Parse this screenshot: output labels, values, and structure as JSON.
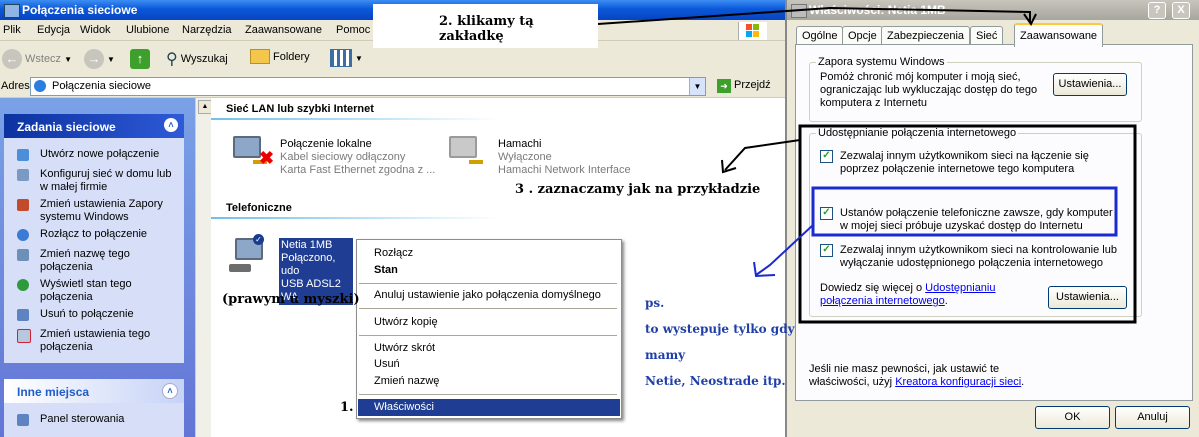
{
  "explorer": {
    "title": "Połączenia sieciowe",
    "menu": [
      "Plik",
      "Edycja",
      "Widok",
      "Ulubione",
      "Narzędzia",
      "Zaawansowane",
      "Pomoc"
    ],
    "toolbar": {
      "back": "Wstecz",
      "search": "Wyszukaj",
      "folders": "Foldery"
    },
    "address": {
      "label": "Adres",
      "value": "Połączenia sieciowe",
      "go": "Przejdź"
    },
    "tasks": {
      "header": "Zadania sieciowe",
      "items": [
        "Utwórz nowe połączenie",
        "Konfiguruj sieć w domu lub w małej firmie",
        "Zmień ustawienia Zapory systemu Windows",
        "Rozłącz to połączenie",
        "Zmień nazwę tego połączenia",
        "Wyświetl stan tego połączenia",
        "Usuń to połączenie",
        "Zmień ustawienia tego połączenia"
      ]
    },
    "places": {
      "header": "Inne miejsca",
      "items": [
        "Panel sterowania"
      ]
    },
    "groups": {
      "lan": "Sieć LAN lub szybki Internet",
      "phone": "Telefoniczne"
    },
    "connections": {
      "local": {
        "name": "Połączenie lokalne",
        "status": "Kabel sieciowy odłączony",
        "device": "Karta Fast Ethernet zgodna z ..."
      },
      "hamachi": {
        "name": "Hamachi",
        "status": "Wyłączone",
        "device": "Hamachi Network Interface"
      },
      "netia": {
        "name": "Netia 1MB",
        "status": "Połączono, udo",
        "device": "USB ADSL2 WA"
      }
    },
    "context_menu": {
      "items": [
        "Rozłącz",
        "Stan",
        "Anuluj ustawienie jako połączenia domyślnego",
        "Utwórz kopię",
        "Utwórz skrót",
        "Usuń",
        "Zmień nazwę",
        "Właściwości"
      ]
    }
  },
  "props": {
    "title": "Właściwości: Netia 1MB",
    "tabs": [
      "Ogólne",
      "Opcje",
      "Zabezpieczenia",
      "Sieć",
      "Zaawansowane"
    ],
    "firewall": {
      "legend": "Zapora systemu Windows",
      "text": [
        "Pomóż chronić mój komputer i moją sieć,",
        "ograniczając lub wykluczając dostęp do tego",
        "komputera z Internetu"
      ],
      "button": "Ustawienia..."
    },
    "ics": {
      "legend": "Udostępnianie połączenia internetowego",
      "cb1": [
        "Zezwalaj innym użytkownikom sieci na łączenie się",
        "poprzez połączenie internetowe tego komputera"
      ],
      "cb2": [
        "Ustanów połączenie telefoniczne zawsze, gdy komputer",
        "w mojej sieci próbuje uzyskać dostęp do Internetu"
      ],
      "cb3": [
        "Zezwalaj innym użytkownikom sieci na kontrolowanie lub",
        "wyłączanie udostępnionego połączenia internetowego"
      ],
      "more_prefix": "Dowiedz się więcej o ",
      "more_link1": "Udostępnianiu",
      "more_link2": "połączenia internetowego",
      "more_suffix": ".",
      "button": "Ustawienia..."
    },
    "hint": {
      "line1": "Jeśli nie masz pewności, jak ustawić te",
      "line2_prefix": "właściwości, użyj ",
      "line2_link": "Kreatora konfiguracji sieci",
      "line2_suffix": "."
    },
    "ok": "OK",
    "cancel": "Anuluj",
    "help_btn": "?",
    "close_btn": "X"
  },
  "annotations": {
    "step1": "1.",
    "step2": "2. klikamy tą zakładkę",
    "step3": "3 . zaznaczamy jak na przykładzie",
    "right_click": "(prawym u myszki)",
    "ps": [
      "ps.",
      "to wystepuje tylko gdy",
      "mamy",
      "Netie, Neostrade itp."
    ]
  }
}
